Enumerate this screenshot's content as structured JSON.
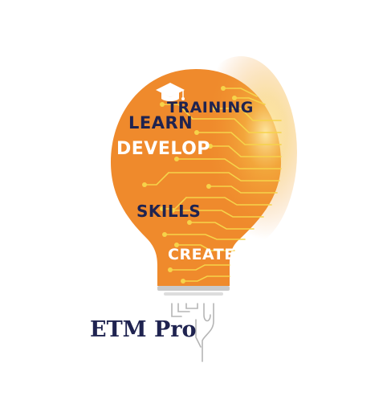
{
  "logo": {
    "words": {
      "training": "TRAINING",
      "learn": "LEARN",
      "develop": "DEVELOP",
      "skills": "SKILLS",
      "create": "CREATE"
    },
    "brand": "ETM Pro",
    "icon": "graduation-cap-icon",
    "colors": {
      "bulb_orange": "#ef8a2c",
      "dark_navy": "#1f2350",
      "circuit_yellow": "#f6d34a",
      "white": "#ffffff",
      "base_gray": "#c9c9c9"
    }
  }
}
